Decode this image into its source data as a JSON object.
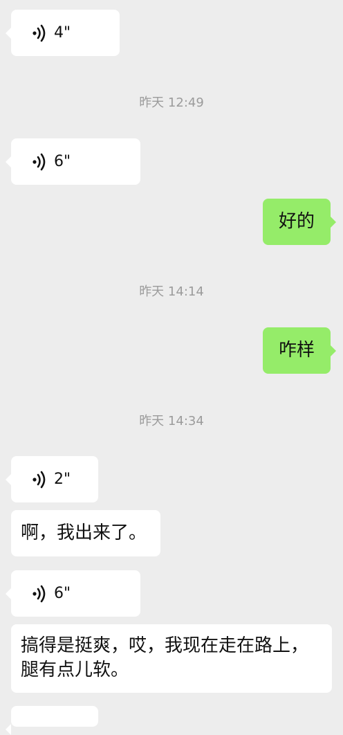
{
  "messages": [
    {
      "type": "voice",
      "side": "left",
      "duration": "4\""
    },
    {
      "type": "time",
      "text": "昨天 12:49"
    },
    {
      "type": "voice",
      "side": "left",
      "duration": "6\""
    },
    {
      "type": "text",
      "side": "right",
      "text": "好的"
    },
    {
      "type": "time",
      "text": "昨天 14:14"
    },
    {
      "type": "text",
      "side": "right",
      "text": "咋样"
    },
    {
      "type": "time",
      "text": "昨天 14:34"
    },
    {
      "type": "voice",
      "side": "left",
      "duration": "2\""
    },
    {
      "type": "text",
      "side": "left",
      "text": "啊，我出来了。"
    },
    {
      "type": "voice",
      "side": "left",
      "duration": "6\""
    },
    {
      "type": "text",
      "side": "left",
      "text": "搞得是挺爽，哎，我现在走在路上，腿有点儿软。"
    }
  ],
  "icons": {
    "voice": "voice-wave-icon"
  },
  "colors": {
    "background": "#ededed",
    "left_bubble": "#ffffff",
    "right_bubble": "#95ec69",
    "time_text": "#9b9b9b"
  }
}
